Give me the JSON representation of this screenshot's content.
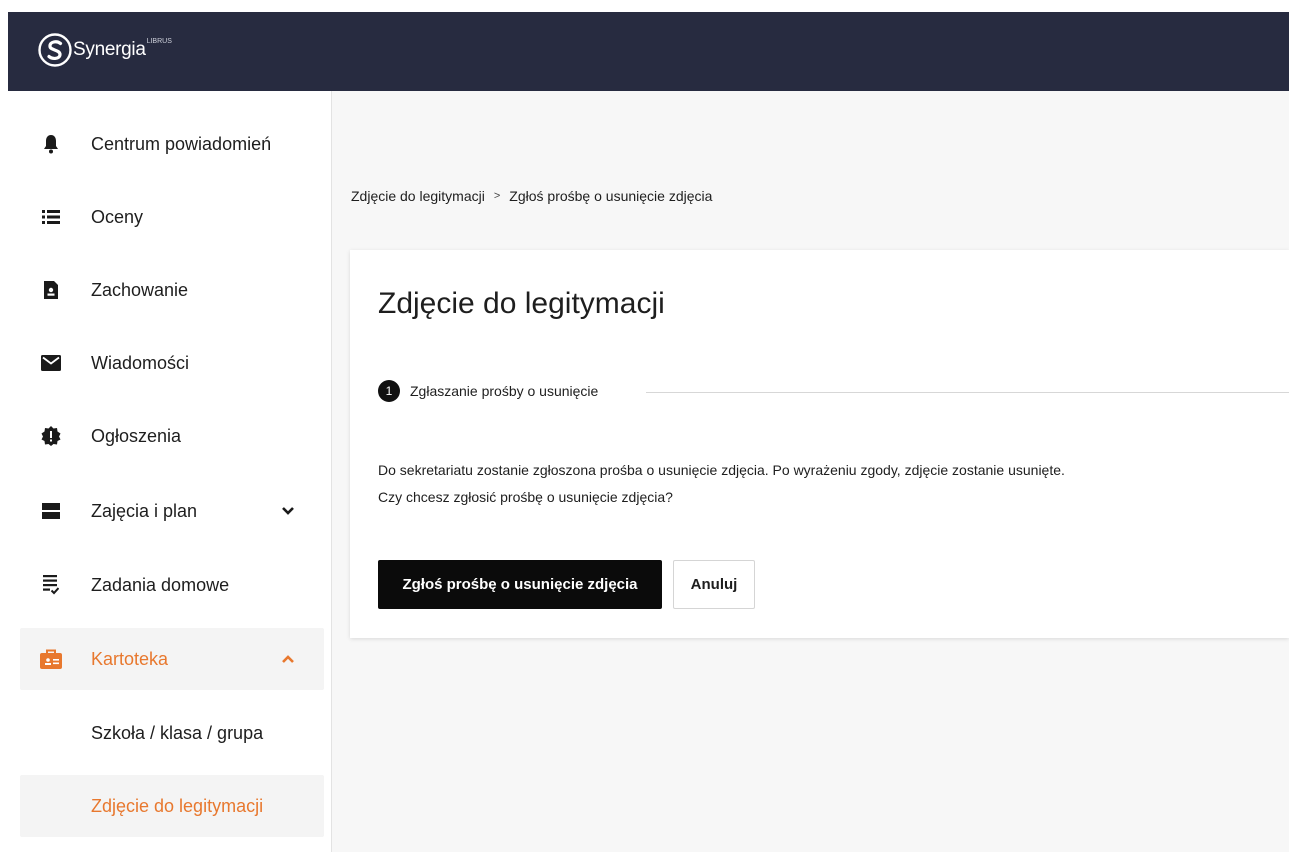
{
  "app": {
    "logo_text": "Synergia",
    "logo_sup": "LIBRUS"
  },
  "sidebar": {
    "items": [
      {
        "label": "Centrum powiadomień",
        "icon": "bell-icon"
      },
      {
        "label": "Oceny",
        "icon": "list-icon"
      },
      {
        "label": "Zachowanie",
        "icon": "badge-document-icon"
      },
      {
        "label": "Wiadomości",
        "icon": "envelope-icon"
      },
      {
        "label": "Ogłoszenia",
        "icon": "alert-seal-icon"
      },
      {
        "label": "Zajęcia i plan",
        "icon": "timetable-icon",
        "expand": "chevron-down-icon"
      },
      {
        "label": "Zadania domowe",
        "icon": "homework-list-icon"
      },
      {
        "label": "Kartoteka",
        "icon": "briefcase-icon",
        "expand": "chevron-up-icon",
        "active": true
      }
    ],
    "subitems": [
      {
        "label": "Szkoła / klasa / grupa"
      },
      {
        "label": "Zdjęcie do legitymacji",
        "active": true
      }
    ],
    "accent_color": "#e8782e"
  },
  "breadcrumb": {
    "items": [
      "Zdjęcie do legitymacji",
      "Zgłoś prośbę o usunięcie zdjęcia"
    ],
    "separator": ">"
  },
  "card": {
    "title": "Zdjęcie do legitymacji",
    "step": {
      "number": "1",
      "label": "Zgłaszanie prośby o usunięcie"
    },
    "message_line1": "Do sekretariatu zostanie zgłoszona prośba o usunięcie zdjęcia. Po wyrażeniu zgody, zdjęcie zostanie usunięte.",
    "message_line2": "Czy chcesz zgłosić prośbę o usunięcie zdjęcia?",
    "primary_button": "Zgłoś prośbę o usunięcie zdjęcia",
    "secondary_button": "Anuluj"
  },
  "colors": {
    "topbar": "#272b40",
    "accent": "#e8782e",
    "primary_button": "#0b0b0b"
  }
}
